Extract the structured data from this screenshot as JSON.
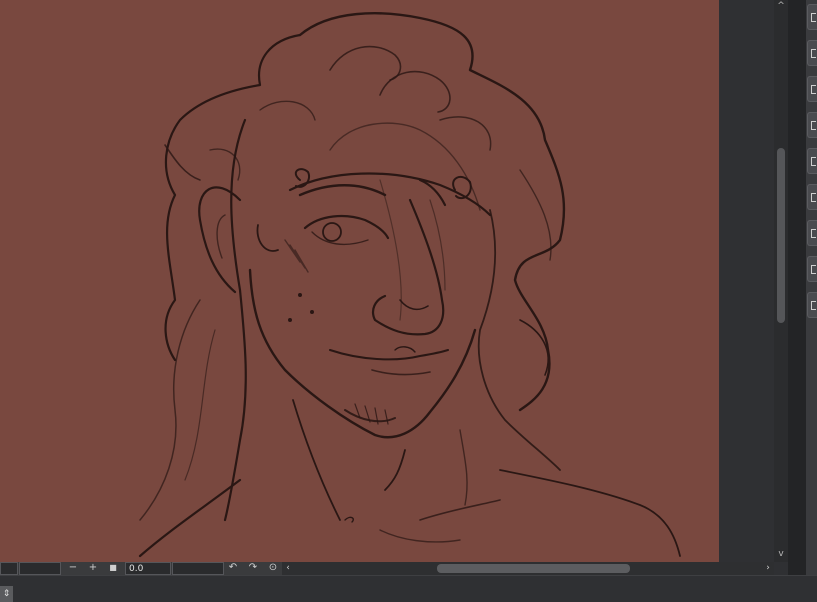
{
  "canvas": {
    "background_color": "#79483f",
    "stroke_color": "#2a1714",
    "content": "sketch-portrait"
  },
  "statusbar": {
    "zoom_out_icon": "minus-icon",
    "zoom_in_icon": "plus-icon",
    "fit_icon": "square-icon",
    "angle_value": "0.0",
    "rotate_left_icon": "rotate-left-icon",
    "rotate_right_icon": "rotate-right-icon",
    "reset_rotation_icon": "reset-rotation-icon",
    "scroll_left_icon": "chevron-left-icon",
    "scroll_right_icon": "chevron-right-icon",
    "zoom_out_glyph": "−",
    "zoom_in_glyph": "+",
    "fit_glyph": "■",
    "rotate_left_glyph": "↶",
    "rotate_right_glyph": "↷",
    "reset_glyph": "⊙",
    "left_glyph": "‹",
    "right_glyph": "›"
  },
  "right_panel": {
    "buttons": [
      "panel-button",
      "panel-button",
      "panel-button",
      "panel-button",
      "panel-button",
      "panel-button",
      "panel-button",
      "panel-button",
      "panel-button"
    ]
  },
  "scrollbar": {
    "up_glyph": "^",
    "down_glyph": "v"
  },
  "bottom": {
    "toggle_glyph": "⇕"
  }
}
